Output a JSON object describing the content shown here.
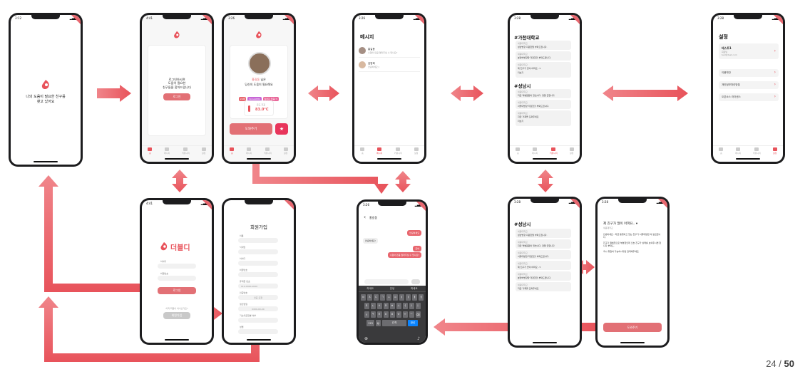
{
  "slide": {
    "current": "24",
    "separator": "/",
    "total": "50"
  },
  "tabs": [
    "홈",
    "메시지",
    "커뮤니티",
    "설정"
  ],
  "splash": {
    "time": "3:12",
    "tagline": "나의 도움이 필요한 친구를\n찾고 있어요"
  },
  "home_guest": {
    "time": "4:41",
    "message": "로그인하시면\n도움이 필요한\n친구들을 찾아드립니다",
    "login_button": "로그인"
  },
  "home_user": {
    "time": "3:26",
    "greeting_name": "홍길동",
    "greeting_suffix": " 님은",
    "greeting_line2": "당신의 도움이 필요해요",
    "tags": [
      {
        "label": "22세",
        "color": "#e8676f"
      },
      {
        "label": "SkinAUMS",
        "color": "#c867d6"
      },
      {
        "label": "알러지 없음(?)",
        "color": "#e86799"
      }
    ],
    "temp_label": "온도 지표",
    "temp_value": "83.0°C",
    "help_button": "도와주기",
    "star_icon": "★"
  },
  "messages": {
    "time": "3:26",
    "title": "메시지",
    "rows": [
      {
        "name": "홍길동",
        "preview": "수험아 만큼 얼마주실 수 있나요?"
      },
      {
        "name": "김영희",
        "preview": "안녕하세요:)"
      }
    ]
  },
  "community": {
    "time": "3:28",
    "sections": [
      {
        "heading": "#가천대학교",
        "posts": [
          {
            "tag": "세종대학교",
            "body": "성남방향 지원한말 부탁드립니다."
          },
          {
            "tag": "세종대학교",
            "body": "분당버방향향 저장한할 부탁드립니다."
          },
          {
            "tag": "세종대학교",
            "body": "제 친구가 많이 아파요.. ▾",
            "more": "더보기"
          }
        ]
      },
      {
        "heading": "#성남시",
        "posts": [
          {
            "tag": "세종대학교",
            "body": "지금 역병원원이 있습니다. 정말 급합니다"
          },
          {
            "tag": "세종대학교",
            "body": "서울대방향 저장한할 부탁드립니다."
          },
          {
            "tag": "세종대학교",
            "body": "지금 거폭을 도와주세요",
            "more": "더보기"
          }
        ]
      }
    ]
  },
  "settings": {
    "time": "3:28",
    "title": "설정",
    "profile_name": "테스트1",
    "profile_sub": "회원님",
    "profile_email": "test@test.com",
    "items": [
      "이용약관",
      "개인정보처리방침",
      "오픈소스 라이센스"
    ]
  },
  "login": {
    "time": "4:41",
    "brand": "더블디",
    "id_label": "아이디",
    "pw_label": "비밀번호",
    "login_button": "로그인",
    "signup_prompt": "아직 회원이 아니신가요?",
    "signup_button": "회원가입"
  },
  "signup": {
    "title": "회원가입",
    "fields": [
      {
        "label": "이름",
        "value": ""
      },
      {
        "label": "닉네임",
        "value": ""
      },
      {
        "label": "아이디",
        "value": ""
      },
      {
        "label": "비밀번호",
        "value": ""
      },
      {
        "label": "휴대폰 번호",
        "value": "010-0000-0000"
      },
      {
        "label": "인증번호",
        "value": "인증 요청"
      },
      {
        "label": "생년월일",
        "value": "0000-00-00"
      },
      {
        "label": "기초의료질병 여부",
        "value": ""
      },
      {
        "label": "성별",
        "value": ""
      }
    ]
  },
  "chat": {
    "time": "3:26",
    "peer": "홍길동",
    "back_icon": "‹",
    "bubbles": [
      {
        "side": "right",
        "text": "안녕하세요"
      },
      {
        "side": "left",
        "text": "안녕하세요!"
      },
      {
        "side": "right",
        "text": "준비"
      },
      {
        "side": "right",
        "text": "수험아 만큼 얼마주실 수 있나요?"
      }
    ],
    "candidates": [
      "하세요",
      "안녕",
      "하네요"
    ],
    "key_rows": [
      [
        "ㅂ",
        "ㅈ",
        "ㄷ",
        "ㄱ",
        "ㅅ",
        "ㅛ",
        "ㅕ",
        "ㅑ",
        "ㅐ",
        "ㅔ"
      ],
      [
        "ㅁ",
        "ㄴ",
        "ㅇ",
        "ㄹ",
        "ㅎ",
        "ㅗ",
        "ㅓ",
        "ㅏ",
        "ㅣ"
      ],
      [
        "⇧",
        "ㅋ",
        "ㅌ",
        "ㅊ",
        "ㅍ",
        "ㅠ",
        "ㅜ",
        "ㅡ",
        "⌫"
      ]
    ],
    "space_label": "간격",
    "go_label": "완료",
    "num_label": "123",
    "emoji_icon": "☺",
    "globe_icon": "⊕",
    "mic_icon": "♪"
  },
  "community_more": {
    "time": "3:28",
    "heading": "#성남시",
    "posts": [
      {
        "tag": "세종대학교",
        "body": "성남방향 지원한말 부탁드립니다."
      },
      {
        "tag": "세종대학교",
        "body": "지금 역병원원이 있습니다. 정말 급합니다"
      },
      {
        "tag": "세종대학교",
        "body": "서울대방향 저장한할 부탁드립니다."
      },
      {
        "tag": "세종대학교",
        "body": "제 친구가 많이 아파요.. ▾"
      },
      {
        "tag": "세종대학교",
        "body": "분당버방향향 저장한할 부탁드립니다."
      },
      {
        "tag": "세종대학교",
        "body": "지금 거폭을 도와주세요"
      }
    ]
  },
  "post_detail": {
    "time": "3:28",
    "title": "제 친구가 많이 아파요.. ▾",
    "author": "세종대학교",
    "body1": "안녕하세요.. 지금 동행하고 있는 친구가 서울대방면 이 필요합니다.",
    "body2": "친구가 절체질으로 부분질인데 오늘 친구가 상태를 보여주시면 합니다 부탁드.",
    "body3": "혹시 위험하 가능하시다면 연락해주세요",
    "help_button": "도와주기"
  },
  "colors": {
    "accent": "#e8535b",
    "arrow_light": "#f0858a",
    "arrow_dark": "#e8535b"
  }
}
